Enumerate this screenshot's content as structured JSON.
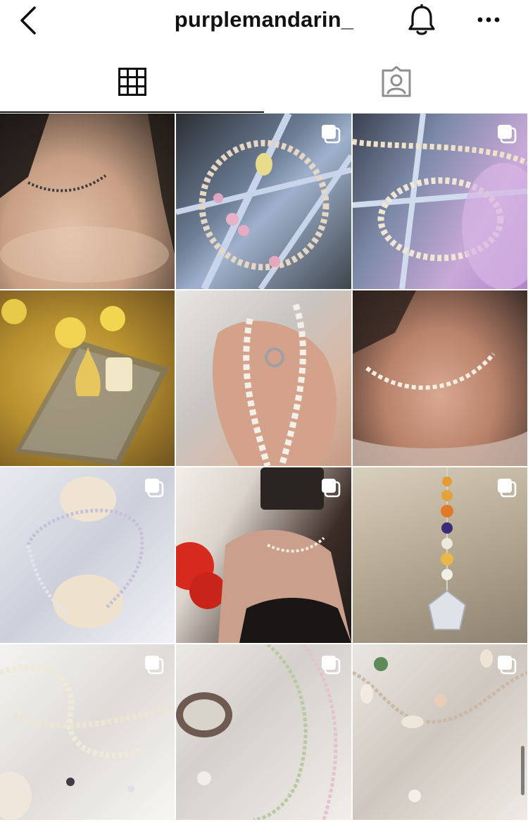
{
  "header": {
    "username": "purplemandarin_",
    "back_icon": "chevron-left-icon",
    "bell_icon": "bell-icon",
    "more_icon": "more-horizontal-icon"
  },
  "tabs": [
    {
      "name": "grid",
      "icon": "grid-icon",
      "active": true
    },
    {
      "name": "tagged",
      "icon": "tagged-person-icon",
      "active": false
    }
  ],
  "posts": [
    {
      "multi": false
    },
    {
      "multi": true
    },
    {
      "multi": true
    },
    {
      "multi": false
    },
    {
      "multi": false
    },
    {
      "multi": false
    },
    {
      "multi": true
    },
    {
      "multi": true
    },
    {
      "multi": true
    },
    {
      "multi": true
    },
    {
      "multi": true
    },
    {
      "multi": true
    }
  ],
  "colors": {
    "text": "#111111",
    "tab_inactive": "#8e8e8e",
    "background": "#ffffff"
  }
}
